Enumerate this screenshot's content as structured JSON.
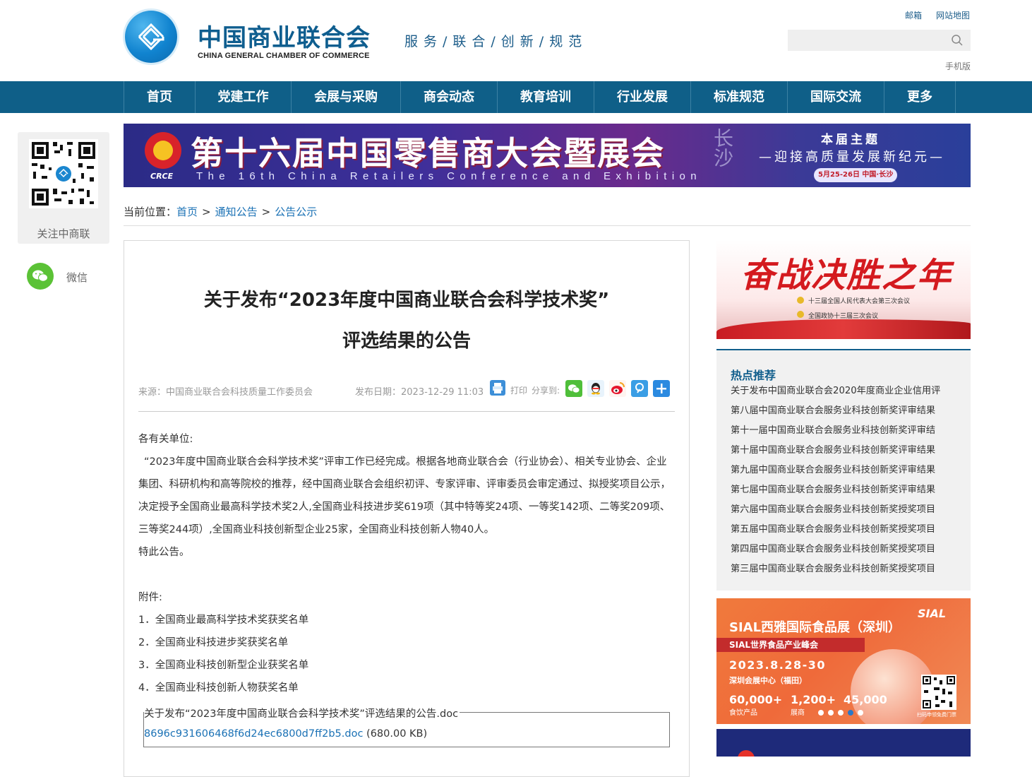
{
  "header": {
    "org_name_cn": "中国商业联合会",
    "org_name_en": "CHINA GENERAL CHAMBER OF COMMERCE",
    "slogan": "服务/联合/创新/规范",
    "links": [
      "邮箱",
      "网站地图"
    ],
    "search_placeholder": "",
    "mobile_label": "手机版"
  },
  "nav": {
    "items": [
      "首页",
      "党建工作",
      "会展与采购",
      "商会动态",
      "教育培训",
      "行业发展",
      "标准规范",
      "国际交流",
      "更多"
    ]
  },
  "float_panel": {
    "qr_label": "关注中商联",
    "wechat_label": "微信"
  },
  "banner": {
    "title": "第十六届中国零售商大会暨展会",
    "subtitle_en": "The 16th China Retailers Conference and Exhibition",
    "logo_text": "CRCE",
    "city": "长沙",
    "theme_heading": "本届主题",
    "theme": "—迎接高质量发展新纪元—",
    "date": "5月25-26日  中国·长沙"
  },
  "breadcrumb": {
    "prefix": "当前位置：",
    "items": [
      "首页",
      "通知公告",
      "公告公示"
    ],
    "sep": ">"
  },
  "article": {
    "title_line1": "关于发布“2023年度中国商业联合会科学技术奖”",
    "title_line2": "评选结果的公告",
    "source": "来源：中国商业联合会科技质量工作委员会",
    "publish_date": "发布日期：2023-12-29 11:03",
    "print_label": "打印",
    "share_label": "分享到:",
    "share_icons": [
      "wechat-icon",
      "qq-icon",
      "weibo-icon",
      "tencent-weibo-icon",
      "more-share-icon"
    ],
    "greeting": "各有关单位:",
    "paragraph": "“2023年度中国商业联合会科学技术奖”评审工作已经完成。根据各地商业联合会（行业协会）、相关专业协会、企业集团、科研机构和高等院校的推荐，经中国商业联合会组织初评、专家评审、评审委员会审定通过、拟授奖项目公示，决定授予全国商业最高科学技术奖2人,全国商业科技进步奖619项（其中特等奖24项、一等奖142项、二等奖209项、三等奖244项）,全国商业科技创新型企业25家，全国商业科技创新人物40人。",
    "closing": "特此公告。",
    "attachments_heading": "附件:",
    "attachments": [
      "1．全国商业最高科学技术奖获奖名单",
      "2．全国商业科技进步奖获奖名单",
      "3．全国商业科技创新型企业获奖名单",
      "4．全国商业科技创新人物获奖名单"
    ],
    "file_name": "关于发布“2023年度中国商业联合会科学技术奖”评选结果的公告.doc",
    "file_link": "8696c931606468f6d24ec6800d7ff2b5.doc",
    "file_size": "(680.00 KB)"
  },
  "sidebar": {
    "ad1": {
      "title": "奋战决胜之年",
      "line1": "十三届全国人民代表大会第三次会议",
      "line2": "全国政协十三届三次会议"
    },
    "hot": {
      "heading": "热点推荐",
      "items": [
        "关于发布中国商业联合会2020年度商业企业信用评",
        "第八届中国商业联合会服务业科技创新奖评审结果",
        "第十一届中国商业联合会服务业科技创新奖评审结",
        "第十届中国商业联合会服务业科技创新奖评审结果",
        "第九届中国商业联合会服务业科技创新奖评审结果",
        "第七届中国商业联合会服务业科技创新奖评审结果",
        "第六届中国商业联合会服务业科技创新奖授奖项目",
        "第五届中国商业联合会服务业科技创新奖授奖项目",
        "第四届中国商业联合会服务业科技创新奖授奖项目",
        "第三届中国商业联合会服务业科技创新奖授奖项目"
      ]
    },
    "ad2": {
      "brand": "SIAL",
      "title": "SIAL西雅国际食品展（深圳）",
      "subtitle": "SIAL世界食品产业峰会",
      "date": "2023.8.28-30",
      "venue": "深圳会展中心（福田）",
      "stats": [
        {
          "value": "60,000+",
          "label": "食饮产品"
        },
        {
          "value": "1,200+",
          "label": "展商"
        },
        {
          "value": "45,000",
          "label": ""
        }
      ],
      "qr_note": "扫码申领免费门票"
    }
  },
  "colors": {
    "nav_bg": "#0f5f88",
    "brand_blue": "#0f5e8f",
    "link_blue": "#1a71b5"
  }
}
